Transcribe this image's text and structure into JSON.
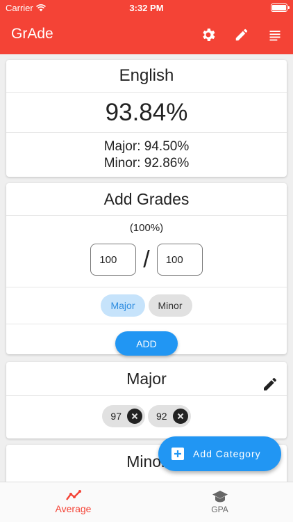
{
  "status_bar": {
    "carrier": "Carrier",
    "time": "3:32 PM"
  },
  "app_bar": {
    "title": "GrAde",
    "icons": [
      "gear-icon",
      "pencil-icon",
      "menu-list-icon"
    ]
  },
  "course": {
    "name": "English",
    "average": "93.84%",
    "major": "Major: 94.50%",
    "minor": "Minor: 92.86%"
  },
  "add_grades": {
    "title": "Add Grades",
    "percent": "(100%)",
    "earned": "100",
    "total": "100",
    "separator": "/",
    "categories": [
      {
        "label": "Major",
        "selected": true
      },
      {
        "label": "Minor",
        "selected": false
      }
    ],
    "add_label": "ADD"
  },
  "major_card": {
    "title": "Major",
    "grades": [
      "97",
      "92"
    ]
  },
  "minor_card": {
    "title": "Minor"
  },
  "fab": {
    "label": "Add Category"
  },
  "bottom_nav": {
    "items": [
      {
        "label": "Average",
        "active": true
      },
      {
        "label": "GPA",
        "active": false
      }
    ]
  },
  "colors": {
    "primary": "#f44336",
    "accent": "#2196f3",
    "chip_selected_bg": "#c6e3fb"
  }
}
